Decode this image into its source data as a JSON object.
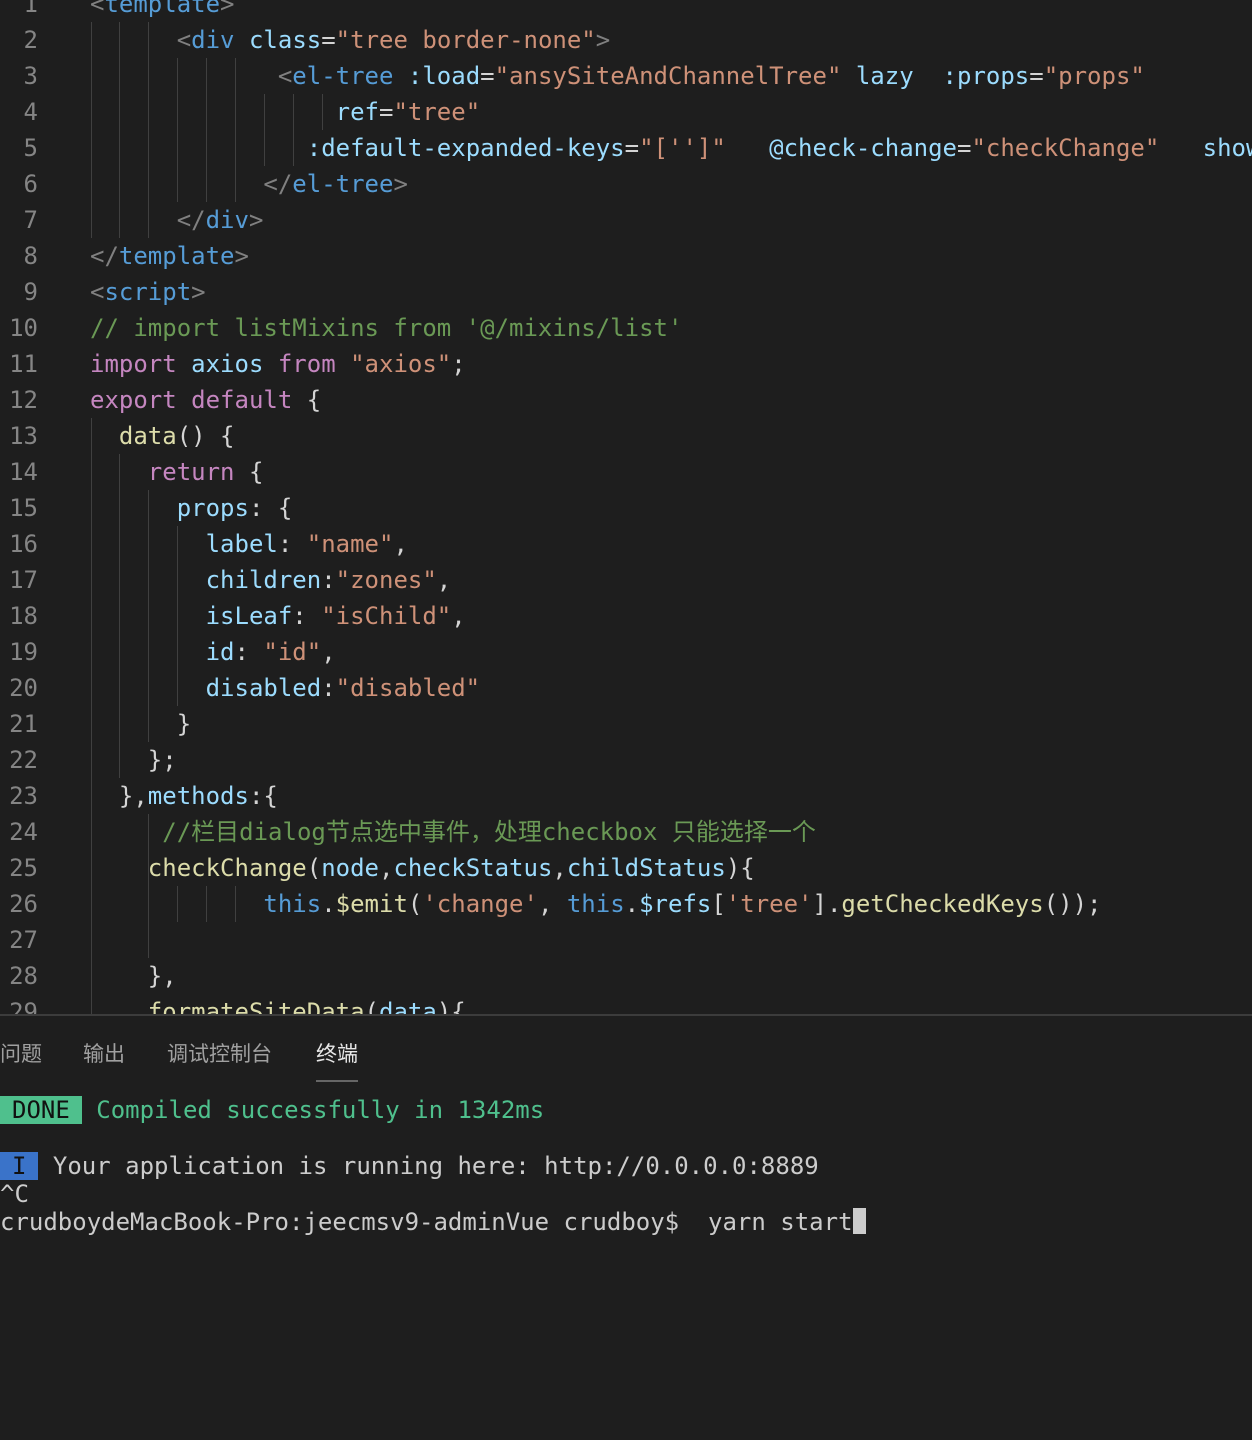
{
  "editor": {
    "lines": [
      [
        [
          "<",
          "p"
        ],
        [
          "template",
          "tg"
        ],
        [
          ">",
          "p"
        ]
      ],
      [
        [
          "      ",
          "d"
        ],
        [
          "<",
          "p"
        ],
        [
          "div",
          "tg"
        ],
        [
          " ",
          "d"
        ],
        [
          "class",
          "at"
        ],
        [
          "=",
          "d"
        ],
        [
          "\"tree border-none\"",
          "s"
        ],
        [
          ">",
          "p"
        ]
      ],
      [
        [
          "             ",
          "d"
        ],
        [
          "<",
          "p"
        ],
        [
          "el-tree",
          "tg"
        ],
        [
          " ",
          "d"
        ],
        [
          ":load",
          "at"
        ],
        [
          "=",
          "d"
        ],
        [
          "\"ansySiteAndChannelTree\"",
          "s"
        ],
        [
          " ",
          "d"
        ],
        [
          "lazy",
          "at"
        ],
        [
          "  ",
          "d"
        ],
        [
          ":props",
          "at"
        ],
        [
          "=",
          "d"
        ],
        [
          "\"props\"",
          "s"
        ]
      ],
      [
        [
          "                 ",
          "d"
        ],
        [
          "ref",
          "at"
        ],
        [
          "=",
          "d"
        ],
        [
          "\"tree\"",
          "s"
        ]
      ],
      [
        [
          "               ",
          "d"
        ],
        [
          ":default-expanded-keys",
          "at"
        ],
        [
          "=",
          "d"
        ],
        [
          "\"['']\"",
          "s"
        ],
        [
          "   ",
          "d"
        ],
        [
          "@check-change",
          "at"
        ],
        [
          "=",
          "d"
        ],
        [
          "\"checkChange\"",
          "s"
        ],
        [
          "   ",
          "d"
        ],
        [
          "show",
          "at"
        ]
      ],
      [
        [
          "            ",
          "d"
        ],
        [
          "</",
          "p"
        ],
        [
          "el-tree",
          "tg"
        ],
        [
          ">",
          "p"
        ]
      ],
      [
        [
          "      ",
          "d"
        ],
        [
          "</",
          "p"
        ],
        [
          "div",
          "tg"
        ],
        [
          ">",
          "p"
        ]
      ],
      [
        [
          "</",
          "p"
        ],
        [
          "template",
          "tg"
        ],
        [
          ">",
          "p"
        ]
      ],
      [
        [
          "<",
          "p"
        ],
        [
          "script",
          "tg"
        ],
        [
          ">",
          "p"
        ]
      ],
      [
        [
          "// import listMixins from '@/mixins/list'",
          "c"
        ]
      ],
      [
        [
          "import",
          "k"
        ],
        [
          " axios ",
          "at"
        ],
        [
          "from",
          "k"
        ],
        [
          " ",
          "d"
        ],
        [
          "\"axios\"",
          "s"
        ],
        [
          ";",
          "d"
        ]
      ],
      [
        [
          "export",
          "k"
        ],
        [
          " ",
          "d"
        ],
        [
          "default",
          "k"
        ],
        [
          " {",
          "d"
        ]
      ],
      [
        [
          "  ",
          "d"
        ],
        [
          "data",
          "f"
        ],
        [
          "() {",
          "d"
        ]
      ],
      [
        [
          "    ",
          "d"
        ],
        [
          "return",
          "k"
        ],
        [
          " {",
          "d"
        ]
      ],
      [
        [
          "      ",
          "d"
        ],
        [
          "props",
          "at"
        ],
        [
          ": {",
          "d"
        ]
      ],
      [
        [
          "        ",
          "d"
        ],
        [
          "label",
          "at"
        ],
        [
          ": ",
          "d"
        ],
        [
          "\"name\"",
          "s"
        ],
        [
          ",",
          "d"
        ]
      ],
      [
        [
          "        ",
          "d"
        ],
        [
          "children",
          "at"
        ],
        [
          ":",
          "d"
        ],
        [
          "\"zones\"",
          "s"
        ],
        [
          ",",
          "d"
        ]
      ],
      [
        [
          "        ",
          "d"
        ],
        [
          "isLeaf",
          "at"
        ],
        [
          ": ",
          "d"
        ],
        [
          "\"isChild\"",
          "s"
        ],
        [
          ",",
          "d"
        ]
      ],
      [
        [
          "        ",
          "d"
        ],
        [
          "id",
          "at"
        ],
        [
          ": ",
          "d"
        ],
        [
          "\"id\"",
          "s"
        ],
        [
          ",",
          "d"
        ]
      ],
      [
        [
          "        ",
          "d"
        ],
        [
          "disabled",
          "at"
        ],
        [
          ":",
          "d"
        ],
        [
          "\"disabled\"",
          "s"
        ]
      ],
      [
        [
          "      }",
          "d"
        ]
      ],
      [
        [
          "    };",
          "d"
        ]
      ],
      [
        [
          "  },",
          "d"
        ],
        [
          "methods",
          "at"
        ],
        [
          ":{",
          "d"
        ]
      ],
      [
        [
          "     ",
          "d"
        ],
        [
          "//栏目dialog节点选中事件，处理checkbox 只能选择一个",
          "c"
        ]
      ],
      [
        [
          "    ",
          "d"
        ],
        [
          "checkChange",
          "f"
        ],
        [
          "(",
          "d"
        ],
        [
          "node",
          "at"
        ],
        [
          ",",
          "d"
        ],
        [
          "checkStatus",
          "at"
        ],
        [
          ",",
          "d"
        ],
        [
          "childStatus",
          "at"
        ],
        [
          "){",
          "d"
        ]
      ],
      [
        [
          "            ",
          "d"
        ],
        [
          "this",
          "b"
        ],
        [
          ".",
          "d"
        ],
        [
          "$emit",
          "f"
        ],
        [
          "(",
          "d"
        ],
        [
          "'change'",
          "s"
        ],
        [
          ", ",
          "d"
        ],
        [
          "this",
          "b"
        ],
        [
          ".",
          "d"
        ],
        [
          "$refs",
          "at"
        ],
        [
          "[",
          "d"
        ],
        [
          "'tree'",
          "s"
        ],
        [
          "].",
          "d"
        ],
        [
          "getCheckedKeys",
          "f"
        ],
        [
          "());",
          "d"
        ]
      ],
      [
        [
          "",
          "d"
        ]
      ],
      [
        [
          "    },",
          "d"
        ]
      ],
      [
        [
          "    ",
          "d"
        ],
        [
          "formateSiteData",
          "f"
        ],
        [
          "(",
          "d"
        ],
        [
          "data",
          "at"
        ],
        [
          "){",
          "d"
        ]
      ]
    ]
  },
  "panel": {
    "tabs": [
      "问题",
      "输出",
      "调试控制台",
      "终端"
    ],
    "active_tab": "终端",
    "terminal": {
      "done_badge": "DONE",
      "done_text": "Compiled successfully in 1342ms",
      "info_badge": "I",
      "info_text": "Your application is running here: http://0.0.0.0:8889",
      "interrupt": "^C",
      "prompt": "crudboydeMacBook-Pro:jeecmsv9-adminVue crudboy$",
      "command": "yarn start"
    }
  }
}
